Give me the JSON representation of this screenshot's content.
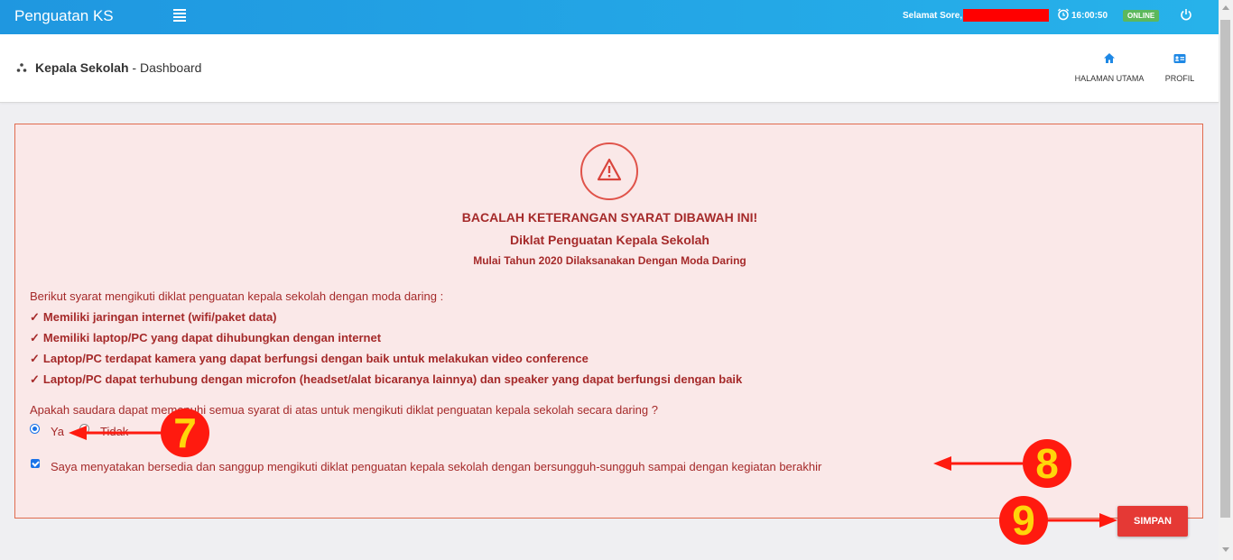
{
  "topbar": {
    "app_title": "Penguatan KS",
    "greeting": "Selamat Sore,",
    "time": "16:00:50",
    "status_badge": "ONLINE"
  },
  "header": {
    "role": "Kepala Sekolah",
    "separator": " - ",
    "page": "Dashboard",
    "nav": {
      "home_label": "HALAMAN UTAMA",
      "profile_label": "PROFIL"
    }
  },
  "notice": {
    "heading": "BACALAH KETERANGAN SYARAT DIBAWAH INI!",
    "subheading": "Diklat Penguatan Kepala Sekolah",
    "note": "Mulai Tahun 2020 Dilaksanakan Dengan Moda Daring",
    "intro": "Berikut syarat mengikuti diklat penguatan kepala sekolah dengan moda daring :",
    "requirements": [
      "Memiliki jaringan internet (wifi/paket data)",
      "Memiliki laptop/PC yang dapat dihubungkan dengan internet",
      "Laptop/PC terdapat kamera yang dapat berfungsi dengan baik untuk melakukan video conference",
      "Laptop/PC dapat terhubung dengan microfon (headset/alat bicaranya lainnya) dan speaker yang dapat berfungsi dengan baik"
    ],
    "question": "Apakah saudara dapat memenuhi semua syarat di atas untuk mengikuti diklat penguatan kepala sekolah secara daring ?",
    "options": {
      "yes": "Ya",
      "no": "Tidak",
      "selected": "Ya"
    },
    "agreement": "Saya menyatakan bersedia dan sanggup mengikuti diklat penguatan kepala sekolah dengan bersungguh-sungguh sampai dengan kegiatan berakhir",
    "agreement_checked": true,
    "save_label": "SIMPAN"
  },
  "annotations": {
    "step_radio": "7",
    "step_agreement": "8",
    "step_save": "9"
  },
  "colors": {
    "topbar": "#27b2ea",
    "panel_bg": "#fae8e8",
    "panel_border": "#e06b4e",
    "text_accent": "#a52a2a",
    "save_button": "#e53935",
    "online_badge": "#5cb85c",
    "annotation": "#ff1a0f"
  }
}
